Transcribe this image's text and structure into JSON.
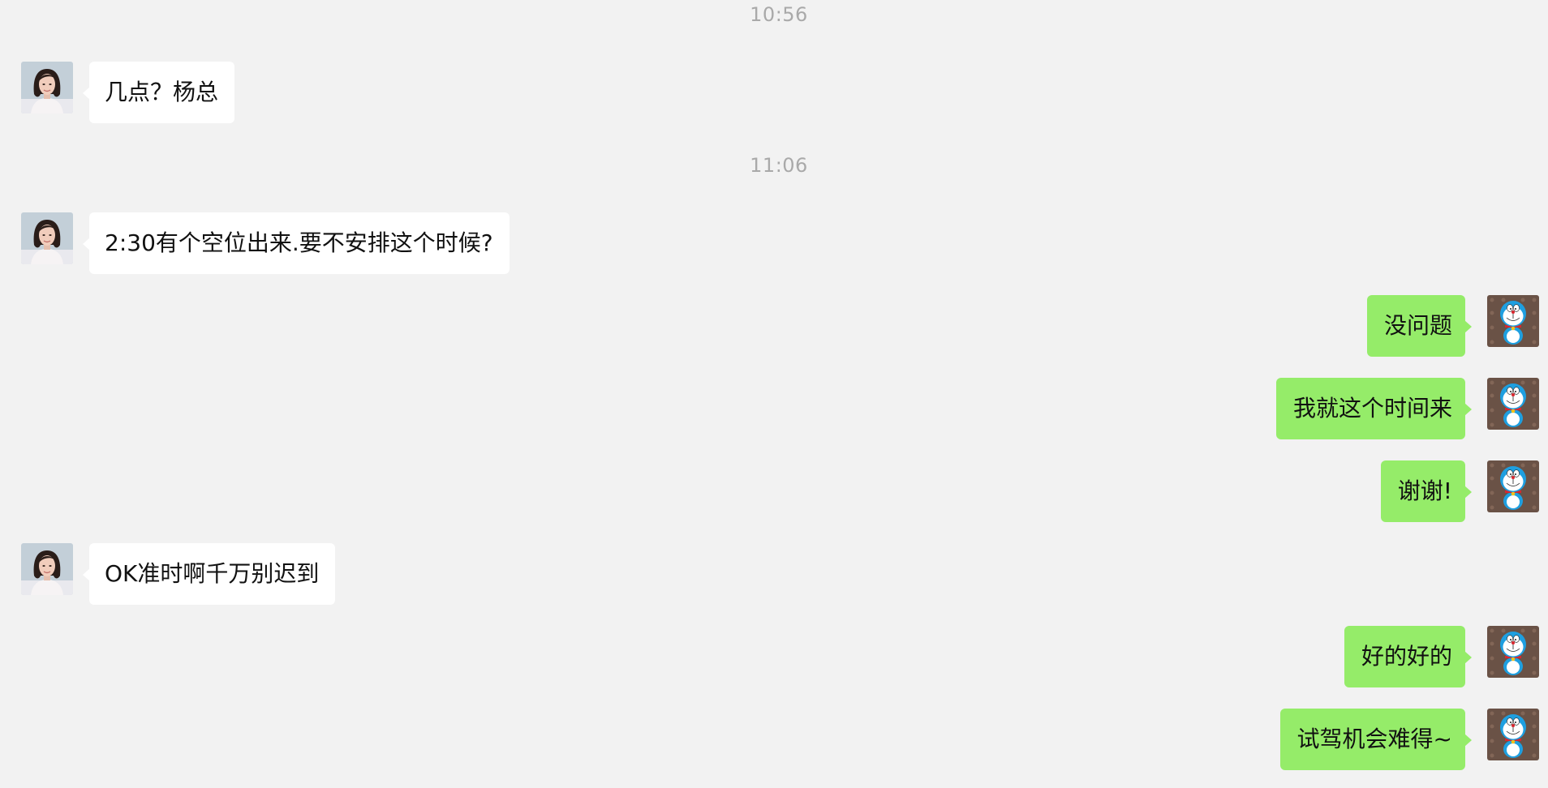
{
  "chat": {
    "timestamps": [
      "10:56",
      "11:06"
    ],
    "messages": [
      {
        "sender": "contact",
        "text": "几点？杨总"
      },
      {
        "sender": "contact",
        "text": "2:30有个空位出来.要不安排这个时候?"
      },
      {
        "sender": "me",
        "text": "没问题"
      },
      {
        "sender": "me",
        "text": "我就这个时间来"
      },
      {
        "sender": "me",
        "text": "谢谢!"
      },
      {
        "sender": "contact",
        "text": "OK准时啊千万别迟到"
      },
      {
        "sender": "me",
        "text": "好的好的"
      },
      {
        "sender": "me",
        "text": "试驾机会难得~"
      }
    ]
  },
  "colors": {
    "background": "#f2f2f2",
    "incoming_bubble": "#ffffff",
    "outgoing_bubble": "#95ec69",
    "timestamp": "#a9a9a9",
    "text": "#111111"
  },
  "icons": {
    "contact_avatar": "woman-portrait-avatar-icon",
    "my_avatar": "doraemon-avatar-icon"
  }
}
